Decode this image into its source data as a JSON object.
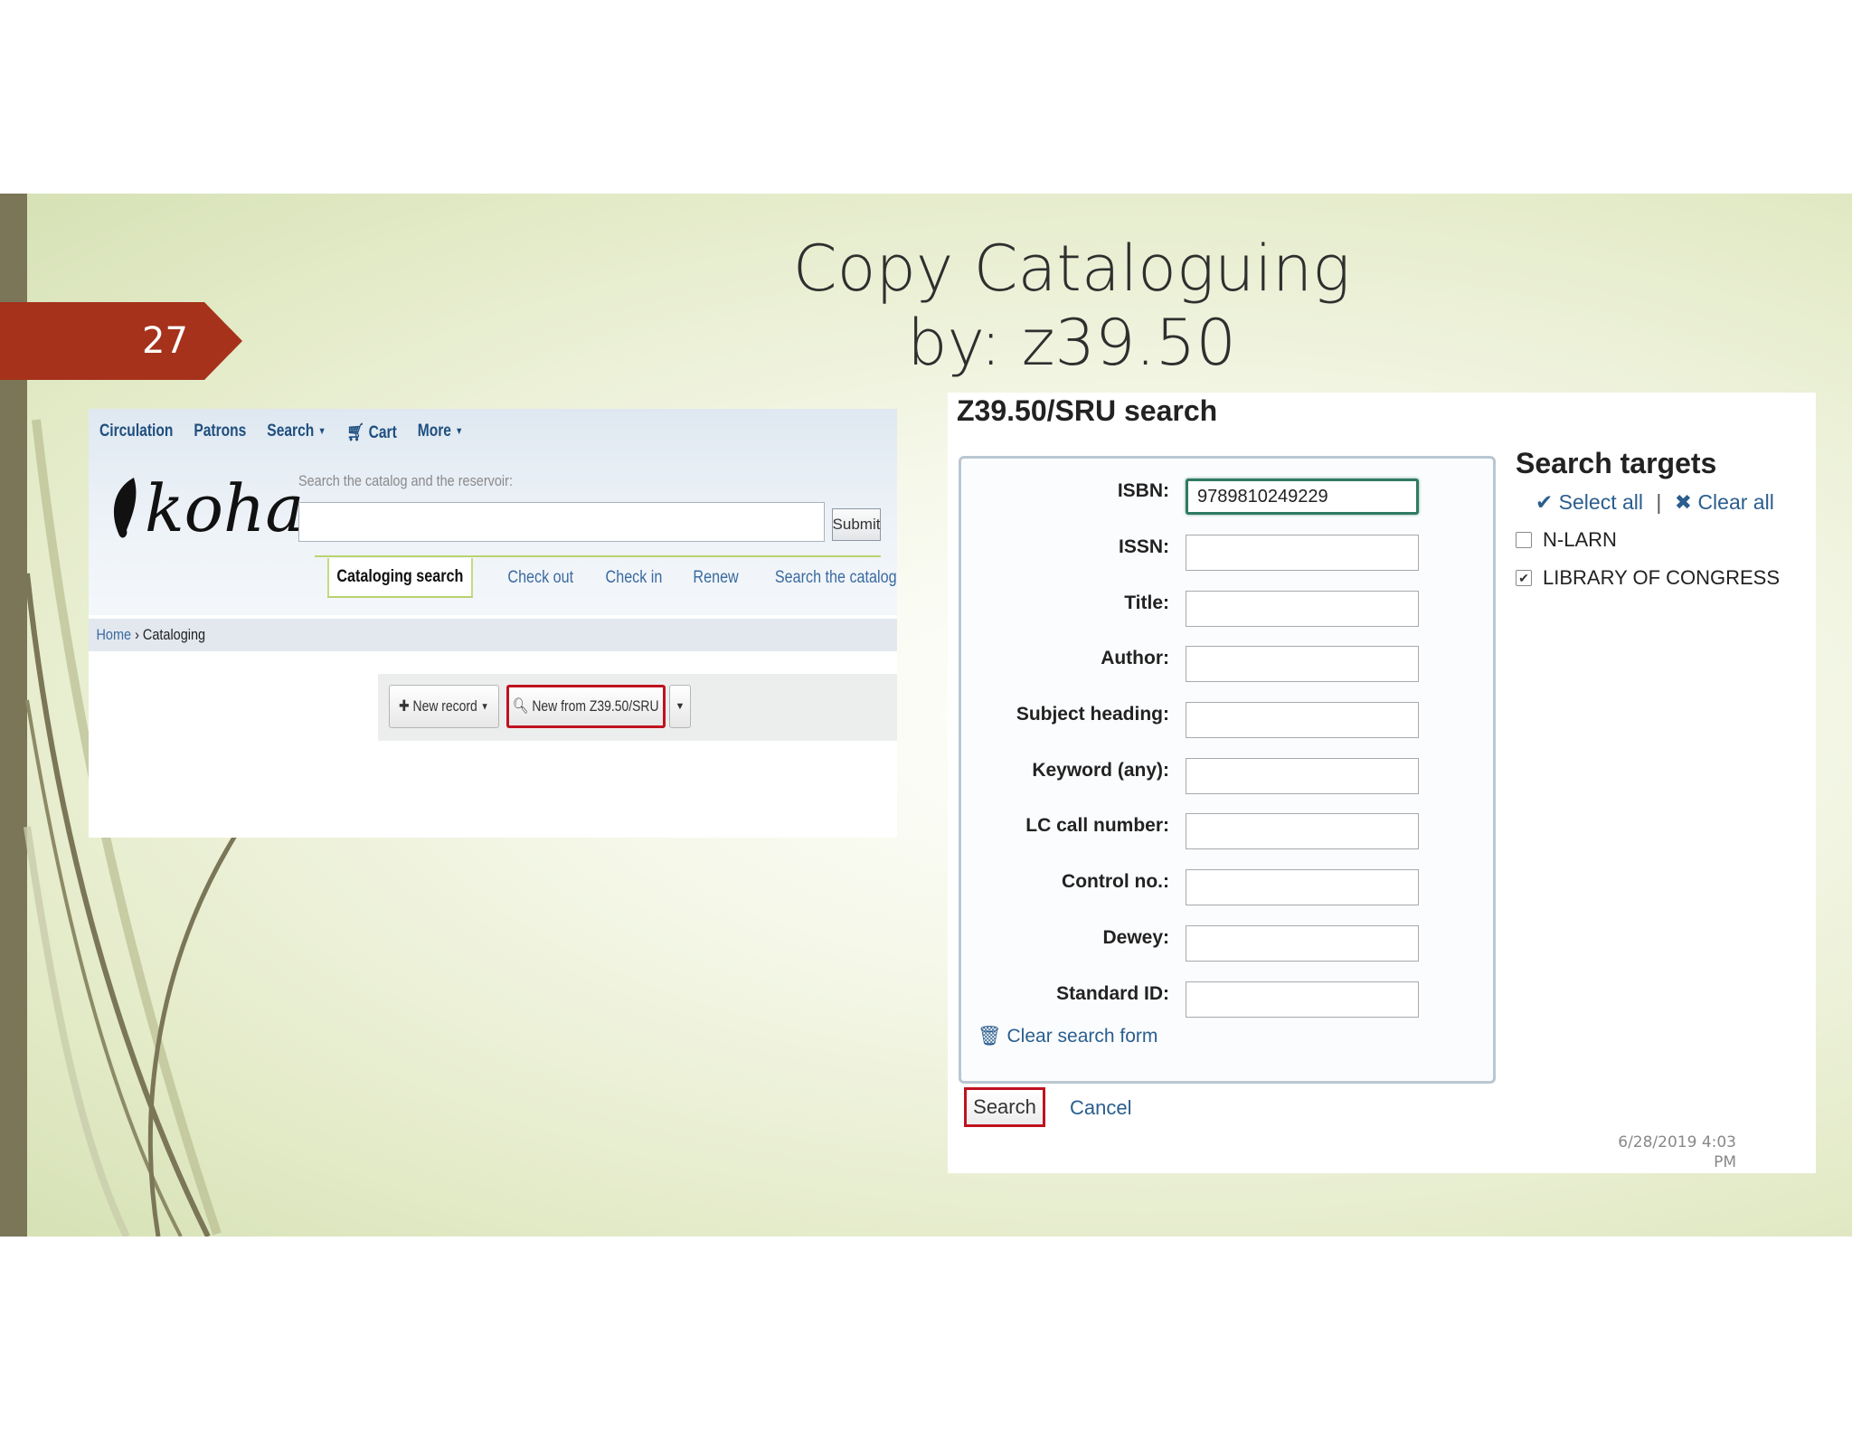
{
  "slide": {
    "number": "27",
    "title_line1": "Copy Cataloguing",
    "title_line2": "by: z39.50",
    "date_line1": "6/28/2019 4:03",
    "date_line2": "PM"
  },
  "koha": {
    "nav": [
      {
        "label": "Circulation"
      },
      {
        "label": "Patrons"
      },
      {
        "label": "Search"
      },
      {
        "label": "Cart"
      },
      {
        "label": "More"
      }
    ],
    "logo_text": "koha",
    "search_label": "Search the catalog and the reservoir:",
    "search_value": "",
    "submit_label": "Submit",
    "tabs": [
      {
        "label": "Cataloging search"
      },
      {
        "label": "Check out"
      },
      {
        "label": "Check in"
      },
      {
        "label": "Renew"
      },
      {
        "label": "Search the catalog"
      }
    ],
    "breadcrumb": {
      "home": "Home",
      "separator": "›",
      "current": "Cataloging"
    },
    "toolbar": {
      "new_record": "New record",
      "new_from_z": "New from Z39.50/SRU"
    },
    "colors": {
      "highlight": "#c0121f",
      "link": "#3a6aa0"
    }
  },
  "z3950": {
    "title": "Z39.50/SRU search",
    "fields": [
      {
        "label": "ISBN:",
        "value": "9789810249229"
      },
      {
        "label": "ISSN:",
        "value": ""
      },
      {
        "label": "Title:",
        "value": ""
      },
      {
        "label": "Author:",
        "value": ""
      },
      {
        "label": "Subject heading:",
        "value": ""
      },
      {
        "label": "Keyword (any):",
        "value": ""
      },
      {
        "label": "LC call number:",
        "value": ""
      },
      {
        "label": "Control no.:",
        "value": ""
      },
      {
        "label": "Dewey:",
        "value": ""
      },
      {
        "label": "Standard ID:",
        "value": ""
      }
    ],
    "clear_form": "Clear search form",
    "search_button": "Search",
    "cancel": "Cancel",
    "targets": {
      "title": "Search targets",
      "select_all": "Select all",
      "separator": "|",
      "clear_all": "Clear all",
      "items": [
        {
          "label": "N-LARN",
          "checked": false
        },
        {
          "label": "LIBRARY OF CONGRESS",
          "checked": true
        }
      ]
    }
  },
  "theme": {
    "accent": "#a6321c",
    "bar": "#7a7657"
  }
}
